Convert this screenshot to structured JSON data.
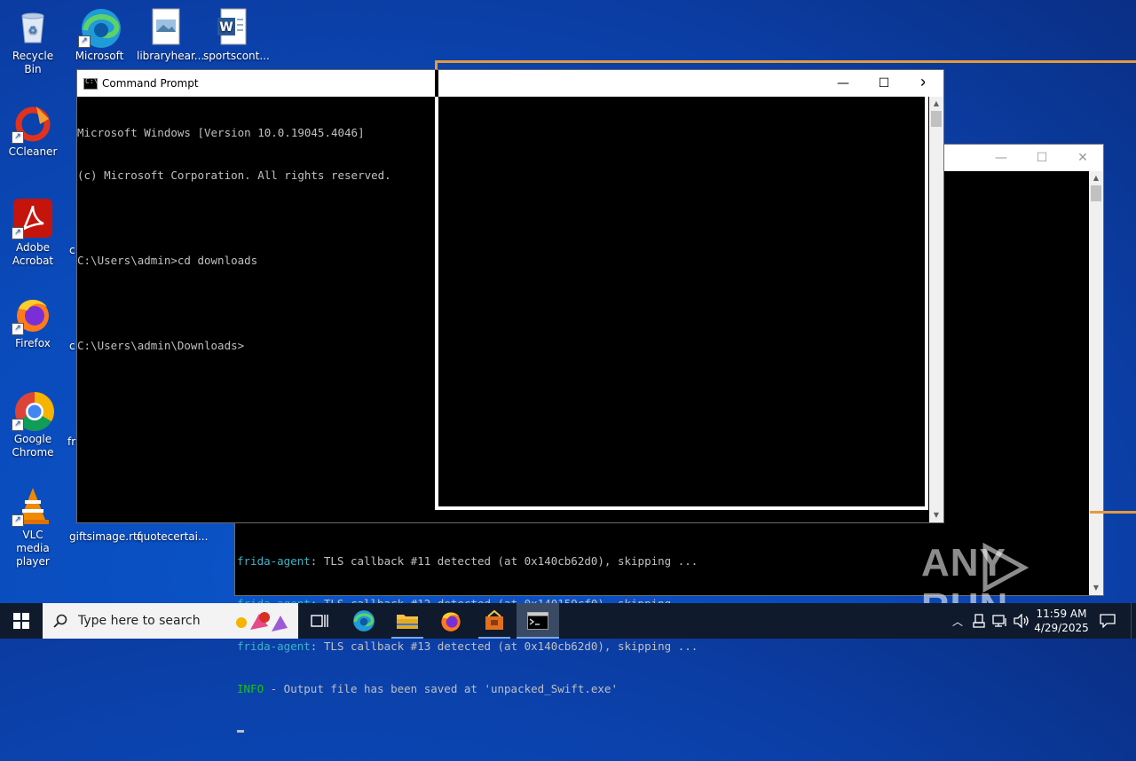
{
  "desktop": {
    "icons": [
      {
        "name": "recycle-bin",
        "label": "Recycle Bin"
      },
      {
        "name": "microsoft-edge",
        "label": "Microsoft Edge"
      },
      {
        "name": "libraryhear-file",
        "label": "libraryhear..."
      },
      {
        "name": "sportscont-file",
        "label": "sportscont..."
      },
      {
        "name": "ccleaner",
        "label": "CCleaner"
      },
      {
        "name": "adobe-acrobat",
        "label": "Adobe Acrobat"
      },
      {
        "name": "firefox",
        "label": "Firefox"
      },
      {
        "name": "google-chrome",
        "label": "Google Chrome"
      },
      {
        "name": "vlc",
        "label": "VLC media player"
      },
      {
        "name": "giftsimage-file",
        "label": "giftsimage.rtf"
      },
      {
        "name": "quotecertai-file",
        "label": "quotecertai..."
      }
    ],
    "partial_labels": [
      "c",
      "c",
      "c",
      "fr"
    ]
  },
  "cmd_main": {
    "title": "Command Prompt",
    "lines": [
      "Microsoft Windows [Version 10.0.19045.4046]",
      "(c) Microsoft Corporation. All rights reserved.",
      "",
      "C:\\Users\\admin>cd downloads",
      "",
      "C:\\Users\\admin\\Downloads>"
    ]
  },
  "cmd_back": {
    "output": [
      {
        "prefix": "frida-agent",
        "text": ": TLS callback #11 detected (at 0x140cb62d0), skipping ..."
      },
      {
        "prefix": "frida-agent",
        "text": ": TLS callback #12 detected (at 0x140159cf0), skipping ..."
      },
      {
        "prefix": "frida-agent",
        "text": ": TLS callback #13 detected (at 0x140cb62d0), skipping ..."
      },
      {
        "prefix": "INFO",
        "text": " - Output file has been saved at 'unpacked_Swift.exe'"
      }
    ]
  },
  "taskbar": {
    "search_placeholder": "Type here to search",
    "time": "11:59 AM",
    "date": "4/29/2025"
  },
  "watermark": "ANY RUN",
  "colors": {
    "frida_prefix": "#3ab4c8",
    "info_prefix": "#16c60c",
    "console_text": "#c0c0c0",
    "overlay_border": "#e39a3c"
  }
}
